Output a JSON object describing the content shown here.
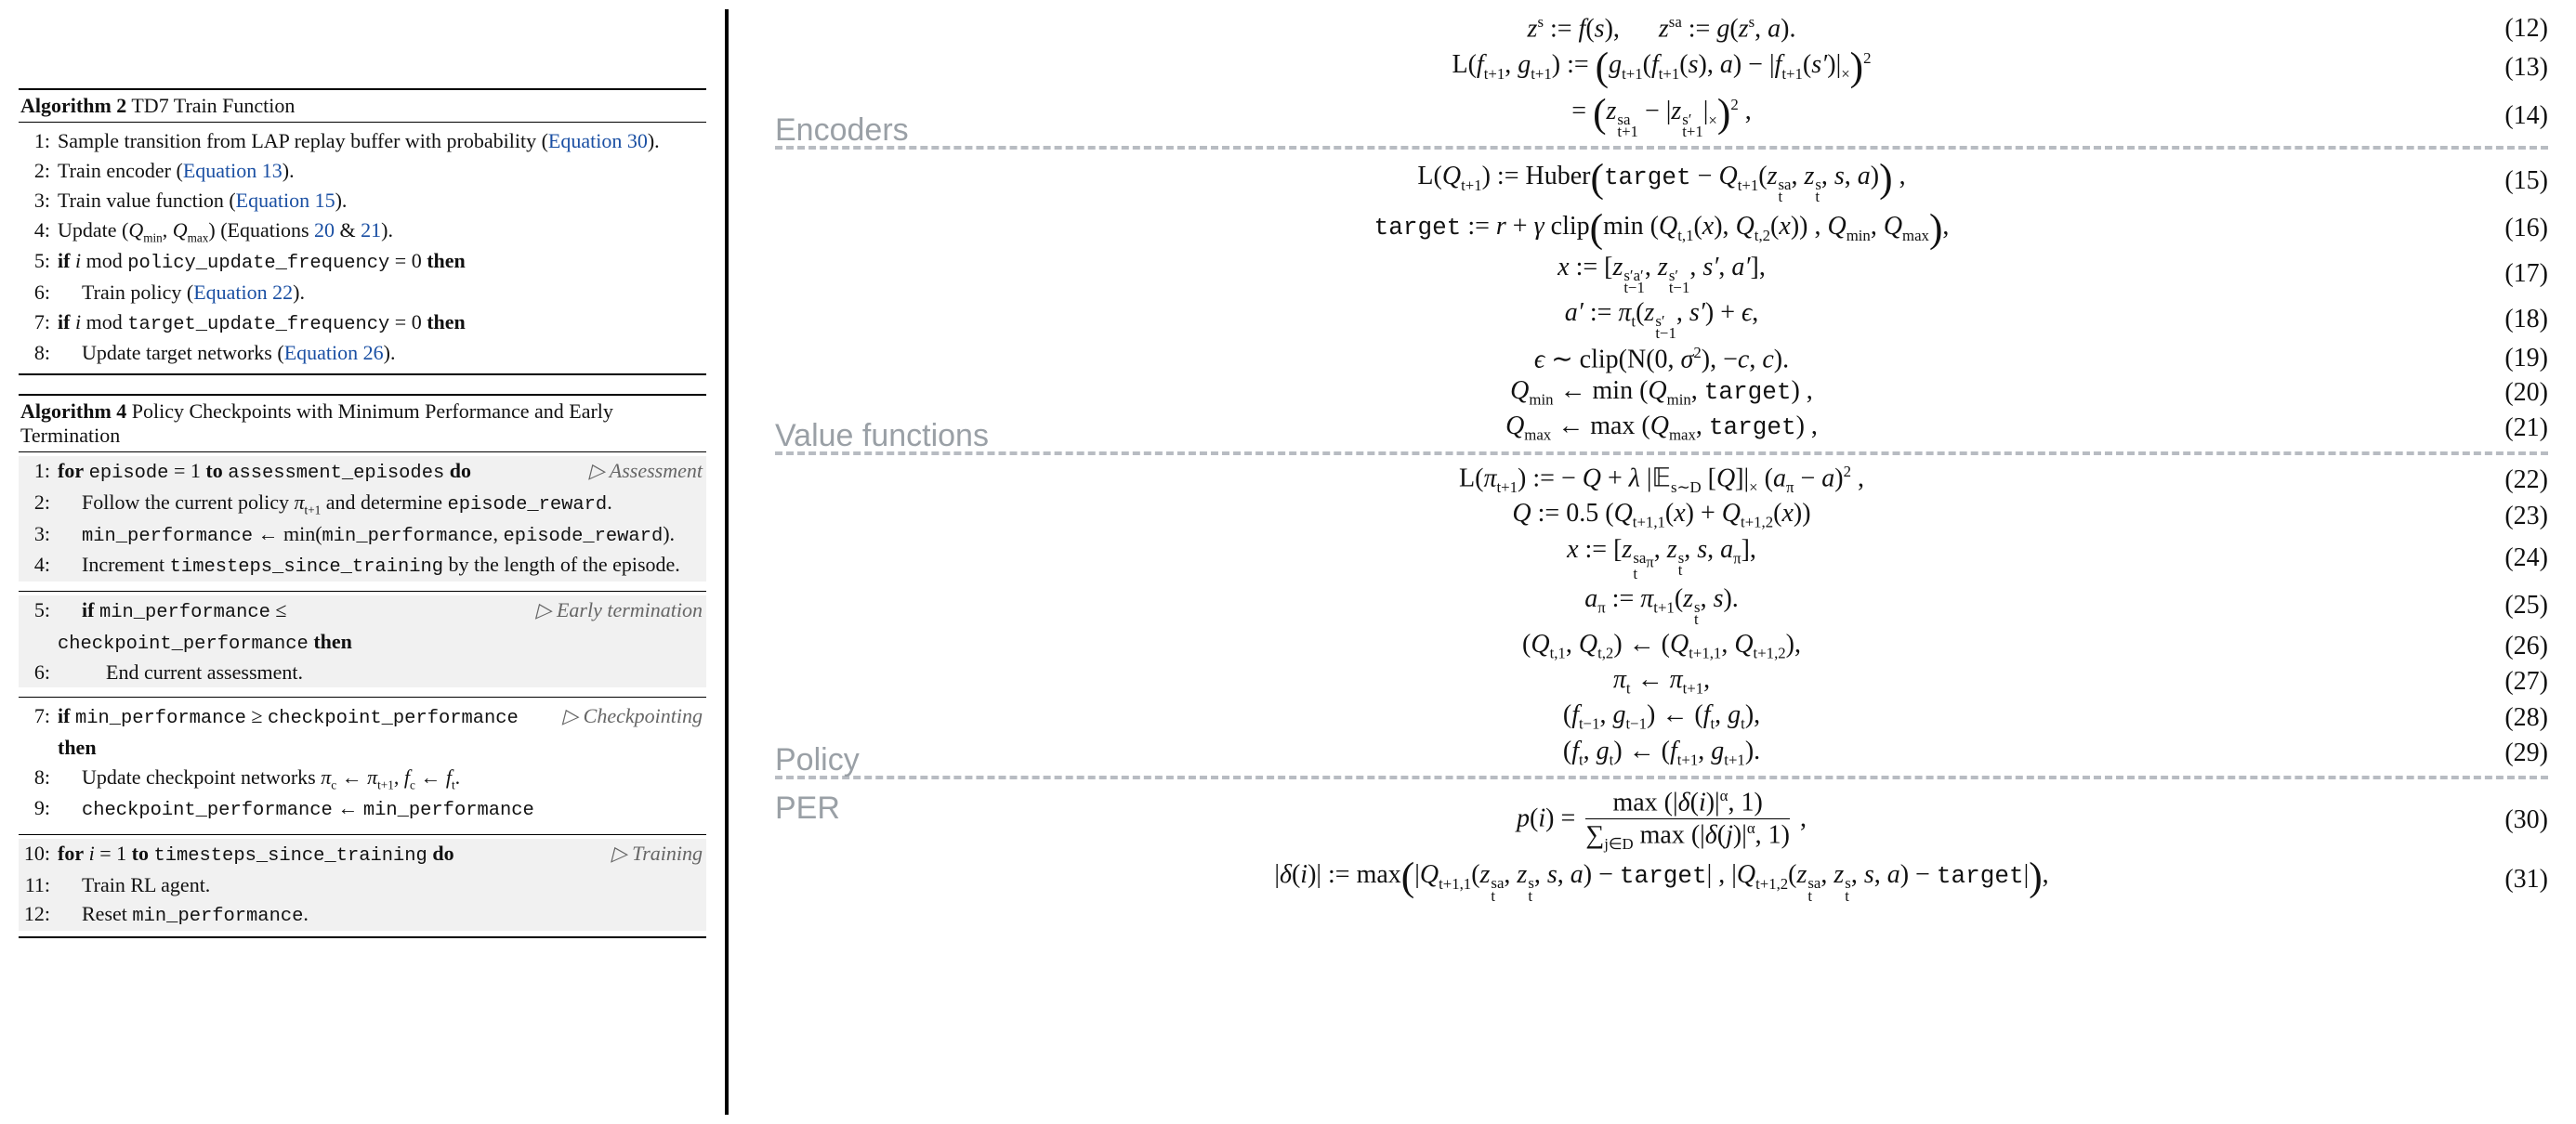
{
  "alg2": {
    "title_bold": "Algorithm 2",
    "title_rest": " TD7 Train Function",
    "lines": [
      {
        "n": "1:",
        "pre": "Sample transition from LAP replay buffer with probability (",
        "link": "Equation 30",
        "post": ")."
      },
      {
        "n": "2:",
        "pre": "Train encoder (",
        "link": "Equation 13",
        "post": ")."
      },
      {
        "n": "3:",
        "pre": "Train value function (",
        "link": "Equation 15",
        "post": ")."
      },
      {
        "n": "4:",
        "pre": "Update (",
        "mid_html": "<span class='it'>Q</span><span class='sub'>min</span>, <span class='it'>Q</span><span class='sub'>max</span>) (Equations ",
        "link": "20",
        "mid2": " & ",
        "link2": "21",
        "post": ")."
      },
      {
        "n": "5:",
        "html": "<b>if</b> <span class='it'>i</span> mod <span class='tt'>policy_update_frequency</span> = 0 <b>then</b>"
      },
      {
        "n": "6:",
        "indent": 1,
        "pre": "Train policy (",
        "link": "Equation 22",
        "post": ")."
      },
      {
        "n": "7:",
        "html": "<b>if</b> <span class='it'>i</span> mod <span class='tt'>target_update_frequency</span> = 0 <b>then</b>"
      },
      {
        "n": "8:",
        "indent": 1,
        "pre": "Update target networks (",
        "link": "Equation 26",
        "post": ")."
      }
    ]
  },
  "alg4": {
    "title_bold": "Algorithm 4",
    "title_rest": " Policy Checkpoints with Minimum Performance and Early Termination",
    "groups": [
      {
        "comment": "▷ Assessment",
        "shade": true,
        "lines": [
          {
            "n": "1:",
            "html": "<b>for</b> <span class='tt'>episode</span> = 1 <b>to</b> <span class='tt'>assessment_episodes</span> <b>do</b>"
          },
          {
            "n": "2:",
            "indent": 1,
            "html": "Follow the current policy <span class='it'>π</span><span class='sub'>t+1</span> and determine <span class='tt'>episode_reward</span>."
          },
          {
            "n": "3:",
            "indent": 1,
            "html": "<span class='tt'>min_performance</span> ← min(<span class='tt'>min_performance</span>, <span class='tt'>episode_reward</span>)."
          },
          {
            "n": "4:",
            "indent": 1,
            "html": "Increment <span class='tt'>timesteps_since_training</span> by the length of the episode."
          }
        ]
      },
      {
        "comment": "▷ Early termination",
        "shade": true,
        "lines": [
          {
            "n": "5:",
            "indent": 1,
            "html": "<b>if</b> <span class='tt'>min_performance</span> ≤ <span class='tt'>checkpoint_performance</span> <b>then</b>"
          },
          {
            "n": "6:",
            "indent": 2,
            "html": "End current assessment."
          }
        ]
      },
      {
        "comment": "▷ Checkpointing",
        "shade": false,
        "lines": [
          {
            "n": "7:",
            "html": "<b>if</b> <span class='tt'>min_performance</span> ≥ <span class='tt'>checkpoint_performance</span> <b>then</b>"
          },
          {
            "n": "8:",
            "indent": 1,
            "html": "Update checkpoint networks <span class='it'>π</span><span class='sub'>c</span> ← <span class='it'>π</span><span class='sub'>t+1</span>, <span class='it'>f</span><span class='sub'>c</span> ← <span class='it'>f</span><span class='sub'>t</span>."
          },
          {
            "n": "9:",
            "indent": 1,
            "html": "<span class='tt'>checkpoint_performance</span> ← <span class='tt'>min_performance</span>"
          }
        ]
      },
      {
        "comment": "▷ Training",
        "shade": true,
        "lines": [
          {
            "n": "10:",
            "html": "<b>for</b> <span class='it'>i</span> = 1 <b>to</b> <span class='tt'>timesteps_since_training</span> <b>do</b>"
          },
          {
            "n": "11:",
            "indent": 1,
            "html": "Train RL agent."
          },
          {
            "n": "12:",
            "indent": 1,
            "html": "Reset <span class='tt'>min_performance</span>."
          }
        ]
      }
    ]
  },
  "sections": {
    "enc": "Encoders",
    "val": "Value functions",
    "pol": "Policy",
    "per": "PER"
  },
  "eqs": [
    {
      "no": "(12)",
      "html": "<span class='it'>z</span><span class='sup'>s</span> := <span class='it'>f</span>(<span class='it'>s</span>), &nbsp;&nbsp;&nbsp;&nbsp; <span class='it'>z</span><span class='sup'>sa</span> := <span class='it'>g</span>(<span class='it'>z</span><span class='sup'>s</span>, <span class='it'>a</span>)."
    },
    {
      "no": "(13)",
      "html": "<span class='script'>L</span>(<span class='it'>f</span><span class='sub'>t+1</span>, <span class='it'>g</span><span class='sub'>t+1</span>) := <span class='big'>(</span><span class='it'>g</span><span class='sub'>t+1</span>(<span class='it'>f</span><span class='sub'>t+1</span>(<span class='it'>s</span>), <span class='it'>a</span>) − |<span class='it'>f</span><span class='sub'>t+1</span>(<span class='it'>s′</span>)|<span class='sub'>×</span><span class='big'>)</span><span class='sup'>2</span>"
    },
    {
      "no": "(14)",
      "html": "= <span class='big'>(</span><span class='it'>z</span><span class='subsup'><span>sa</span><span>t+1</span></span> − |<span class='it'>z</span><span class='subsup'><span>s′</span><span>t+1</span></span>|<span class='sub'>×</span><span class='big'>)</span><span class='sup'>2</span> ,"
    },
    {
      "sep": true,
      "label": "enc"
    },
    {
      "no": "(15)",
      "html": "<span class='script'>L</span>(<span class='it'>Q</span><span class='sub'>t+1</span>) := Huber<span class='big'>(</span><span class='tt'>target</span> − <span class='it'>Q</span><span class='sub'>t+1</span>(<span class='it'>z</span><span class='subsup'><span>sa</span><span>t</span></span>, <span class='it'>z</span><span class='subsup'><span>s</span><span>t</span></span>, <span class='it'>s</span>, <span class='it'>a</span>)<span class='big'>)</span> ,"
    },
    {
      "no": "(16)",
      "html": "<span class='tt'>target</span> := <span class='it'>r</span> + <span class='it'>γ</span> clip<span class='big'>(</span>min (<span class='it'>Q</span><span class='sub'>t,1</span>(<span class='it'>x</span>), <span class='it'>Q</span><span class='sub'>t,2</span>(<span class='it'>x</span>)) , <span class='it'>Q</span><span class='sub'>min</span>, <span class='it'>Q</span><span class='sub'>max</span><span class='big'>)</span>,"
    },
    {
      "no": "(17)",
      "html": "<span class='it'>x</span> := [<span class='it'>z</span><span class='subsup'><span>s′a′</span><span>t−1</span></span>, <span class='it'>z</span><span class='subsup'><span>s′</span><span>t−1</span></span>, <span class='it'>s′</span>, <span class='it'>a′</span>],"
    },
    {
      "no": "(18)",
      "html": "<span class='it'>a′</span> := <span class='it'>π</span><span class='sub'>t</span>(<span class='it'>z</span><span class='subsup'><span>s′</span><span>t−1</span></span>, <span class='it'>s′</span>) + <span class='it'>ϵ</span>,"
    },
    {
      "no": "(19)",
      "html": "<span class='it'>ϵ</span> ∼ clip(<span class='script'>N</span>(0, <span class='it'>σ</span><span class='sup'>2</span>), −<span class='it'>c</span>, <span class='it'>c</span>)."
    },
    {
      "no": "(20)",
      "html": "<span class='it'>Q</span><span class='sub'>min</span> ← min (<span class='it'>Q</span><span class='sub'>min</span>, <span class='tt'>target</span>) ,"
    },
    {
      "no": "(21)",
      "html": "<span class='it'>Q</span><span class='sub'>max</span> ← max (<span class='it'>Q</span><span class='sub'>max</span>, <span class='tt'>target</span>) ,"
    },
    {
      "sep": true,
      "label": "val"
    },
    {
      "no": "(22)",
      "html": "<span class='script'>L</span>(<span class='it'>π</span><span class='sub'>t+1</span>) := − <span class='it'>Q</span> + <span class='it'>λ</span> |𝔼<span class='sub'>s∼D</span> [<span class='it'>Q</span>]|<span class='sub'>×</span> (<span class='it'>a</span><span class='sub'>π</span> − <span class='it'>a</span>)<span class='sup'>2</span> ,"
    },
    {
      "no": "(23)",
      "html": "<span class='it'>Q</span> := 0.5 (<span class='it'>Q</span><span class='sub'>t+1,1</span>(<span class='it'>x</span>) + <span class='it'>Q</span><span class='sub'>t+1,2</span>(<span class='it'>x</span>))"
    },
    {
      "no": "(24)",
      "html": "<span class='it'>x</span> := [<span class='it'>z</span><span class='subsup'><span>sa<sub style='font-size:1em'>π</sub></span><span>t</span></span>, <span class='it'>z</span><span class='subsup'><span>s</span><span>t</span></span>, <span class='it'>s</span>, <span class='it'>a</span><span class='sub'>π</span>],"
    },
    {
      "no": "(25)",
      "html": "<span class='it'>a</span><span class='sub'>π</span> := <span class='it'>π</span><span class='sub'>t+1</span>(<span class='it'>z</span><span class='subsup'><span>s</span><span>t</span></span>, <span class='it'>s</span>)."
    },
    {
      "no": "(26)",
      "html": "(<span class='it'>Q</span><span class='sub'>t,1</span>, <span class='it'>Q</span><span class='sub'>t,2</span>) ← (<span class='it'>Q</span><span class='sub'>t+1,1</span>, <span class='it'>Q</span><span class='sub'>t+1,2</span>),"
    },
    {
      "no": "(27)",
      "html": "<span class='it'>π</span><span class='sub'>t</span> ← <span class='it'>π</span><span class='sub'>t+1</span>,"
    },
    {
      "no": "(28)",
      "html": "(<span class='it'>f</span><span class='sub'>t−1</span>, <span class='it'>g</span><span class='sub'>t−1</span>) ← (<span class='it'>f</span><span class='sub'>t</span>, <span class='it'>g</span><span class='sub'>t</span>),"
    },
    {
      "no": "(29)",
      "html": "(<span class='it'>f</span><span class='sub'>t</span>, <span class='it'>g</span><span class='sub'>t</span>) ← (<span class='it'>f</span><span class='sub'>t+1</span>, <span class='it'>g</span><span class='sub'>t+1</span>)."
    },
    {
      "sep": true,
      "label": "pol"
    },
    {
      "no": "(30)",
      "label_inline": "per",
      "html": "<span class='it'>p</span>(<span class='it'>i</span>) = <span class='frac'><span class='num'>max (|<span class='it'>δ</span>(<span class='it'>i</span>)|<span class='sup'>α</span>, 1)</span><span class='den'>∑<span class='sub'>j∈D</span> max (|<span class='it'>δ</span>(<span class='it'>j</span>)|<span class='sup'>α</span>, 1)</span></span> ,"
    },
    {
      "no": "(31)",
      "html": "|<span class='it'>δ</span>(<span class='it'>i</span>)| := max<span class='big'>(</span>|<span class='it'>Q</span><span class='sub'>t+1,1</span>(<span class='it'>z</span><span class='subsup'><span>sa</span><span>t</span></span>, <span class='it'>z</span><span class='subsup'><span>s</span><span>t</span></span>, <span class='it'>s</span>, <span class='it'>a</span>) − <span class='tt'>target</span>| , |<span class='it'>Q</span><span class='sub'>t+1,2</span>(<span class='it'>z</span><span class='subsup'><span>sa</span><span>t</span></span>, <span class='it'>z</span><span class='subsup'><span>s</span><span>t</span></span>, <span class='it'>s</span>, <span class='it'>a</span>) − <span class='tt'>target</span>|<span class='big'>)</span>,"
    }
  ]
}
